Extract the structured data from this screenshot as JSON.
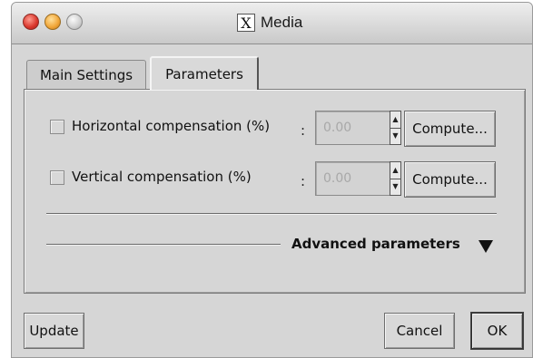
{
  "window": {
    "title": "Media"
  },
  "tabs": [
    {
      "label": "Main Settings",
      "active": false
    },
    {
      "label": "Parameters",
      "active": true
    }
  ],
  "params": {
    "horizontal": {
      "label": "Horizontal compensation (%)",
      "colon": ":",
      "value": "0.00",
      "checked": false,
      "compute_label": "Compute..."
    },
    "vertical": {
      "label": "Vertical compensation (%)",
      "colon": ":",
      "value": "0.00",
      "checked": false,
      "compute_label": "Compute..."
    }
  },
  "advanced": {
    "label": "Advanced parameters",
    "expanded": false
  },
  "buttons": {
    "update": "Update",
    "cancel": "Cancel",
    "ok": "OK"
  },
  "colors": {
    "window_bg": "#d6d6d6",
    "close": "#d9352b",
    "minimize": "#f0a436",
    "maximize": "#cfcfcf",
    "disabled_text": "#a8a8a8"
  },
  "icons": {
    "close": "close-traffic-light-icon",
    "minimize": "minimize-traffic-light-icon",
    "maximize": "maximize-traffic-light-icon",
    "app": "x11-icon",
    "spin_up": "spin-up-icon",
    "spin_down": "spin-down-icon",
    "disclosure": "disclosure-triangle-icon"
  }
}
